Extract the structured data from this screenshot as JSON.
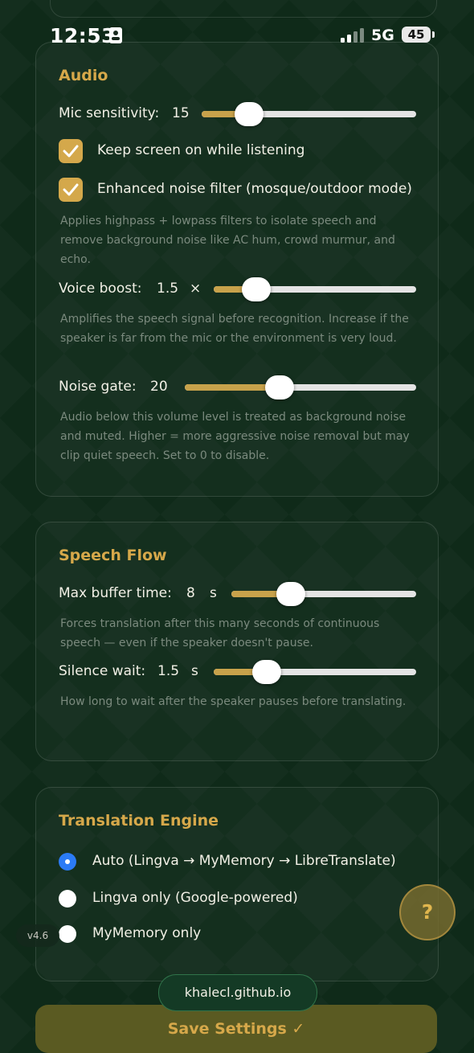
{
  "status_bar": {
    "time": "12:53",
    "network": "5G",
    "battery": "45"
  },
  "audio": {
    "title": "Audio",
    "mic_sensitivity": {
      "label": "Mic sensitivity:",
      "value": "15",
      "fraction": 0.22
    },
    "keep_screen_on": {
      "label": "Keep screen on while listening",
      "checked": true
    },
    "noise_filter": {
      "label": "Enhanced noise filter (mosque/outdoor mode)",
      "checked": true,
      "description": "Applies highpass + lowpass filters to isolate speech and remove background noise like AC hum, crowd murmur, and echo."
    },
    "voice_boost": {
      "label": "Voice boost:",
      "value": "1.5",
      "unit": "×",
      "fraction": 0.21,
      "description": "Amplifies the speech signal before recognition. Increase if the speaker is far from the mic or the environment is very loud."
    },
    "noise_gate": {
      "label": "Noise gate:",
      "value": "20",
      "fraction": 0.41,
      "description": "Audio below this volume level is treated as background noise and muted. Higher = more aggressive noise removal but may clip quiet speech. Set to 0 to disable."
    }
  },
  "speech_flow": {
    "title": "Speech Flow",
    "max_buffer": {
      "label": "Max buffer time:",
      "value": "8",
      "unit": "s",
      "fraction": 0.32,
      "description": "Forces translation after this many seconds of continuous speech — even if the speaker doesn't pause."
    },
    "silence_wait": {
      "label": "Silence wait:",
      "value": "1.5",
      "unit": "s",
      "fraction": 0.26,
      "description": "How long to wait after the speaker pauses before translating."
    }
  },
  "translation_engine": {
    "title": "Translation Engine",
    "options": [
      {
        "label": "Auto (Lingva → MyMemory → LibreTranslate)",
        "selected": true
      },
      {
        "label": "Lingva only (Google-powered)",
        "selected": false
      },
      {
        "label": "MyMemory only",
        "selected": false
      }
    ]
  },
  "overlay": {
    "version": "v4.6",
    "help_label": "?",
    "url": "khalecl.github.io"
  },
  "footer": {
    "save_label": "Save Settings ✓"
  },
  "colors": {
    "accent": "#d4a84b",
    "background": "#0f2a19",
    "radio_selected": "#2b7bf6"
  }
}
